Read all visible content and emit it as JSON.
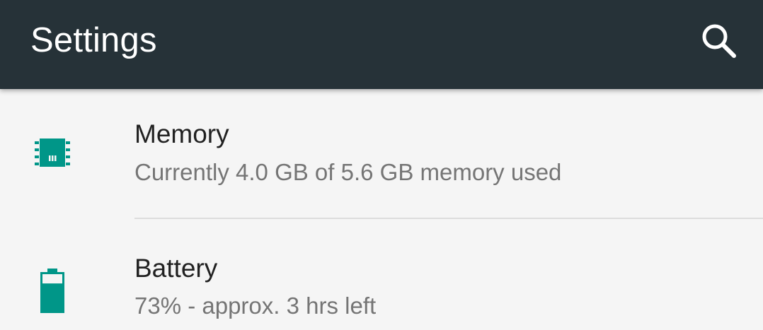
{
  "toolbar": {
    "title": "Settings",
    "background_color": "#263238",
    "action_icon": "search-icon"
  },
  "accent_color": "#009688",
  "items": [
    {
      "icon": "memory-chip-icon",
      "title": "Memory",
      "summary": "Currently 4.0 GB of 5.6 GB memory used"
    },
    {
      "icon": "battery-icon",
      "title": "Battery",
      "summary": "73% - approx. 3 hrs left",
      "level_percent": 73
    }
  ]
}
